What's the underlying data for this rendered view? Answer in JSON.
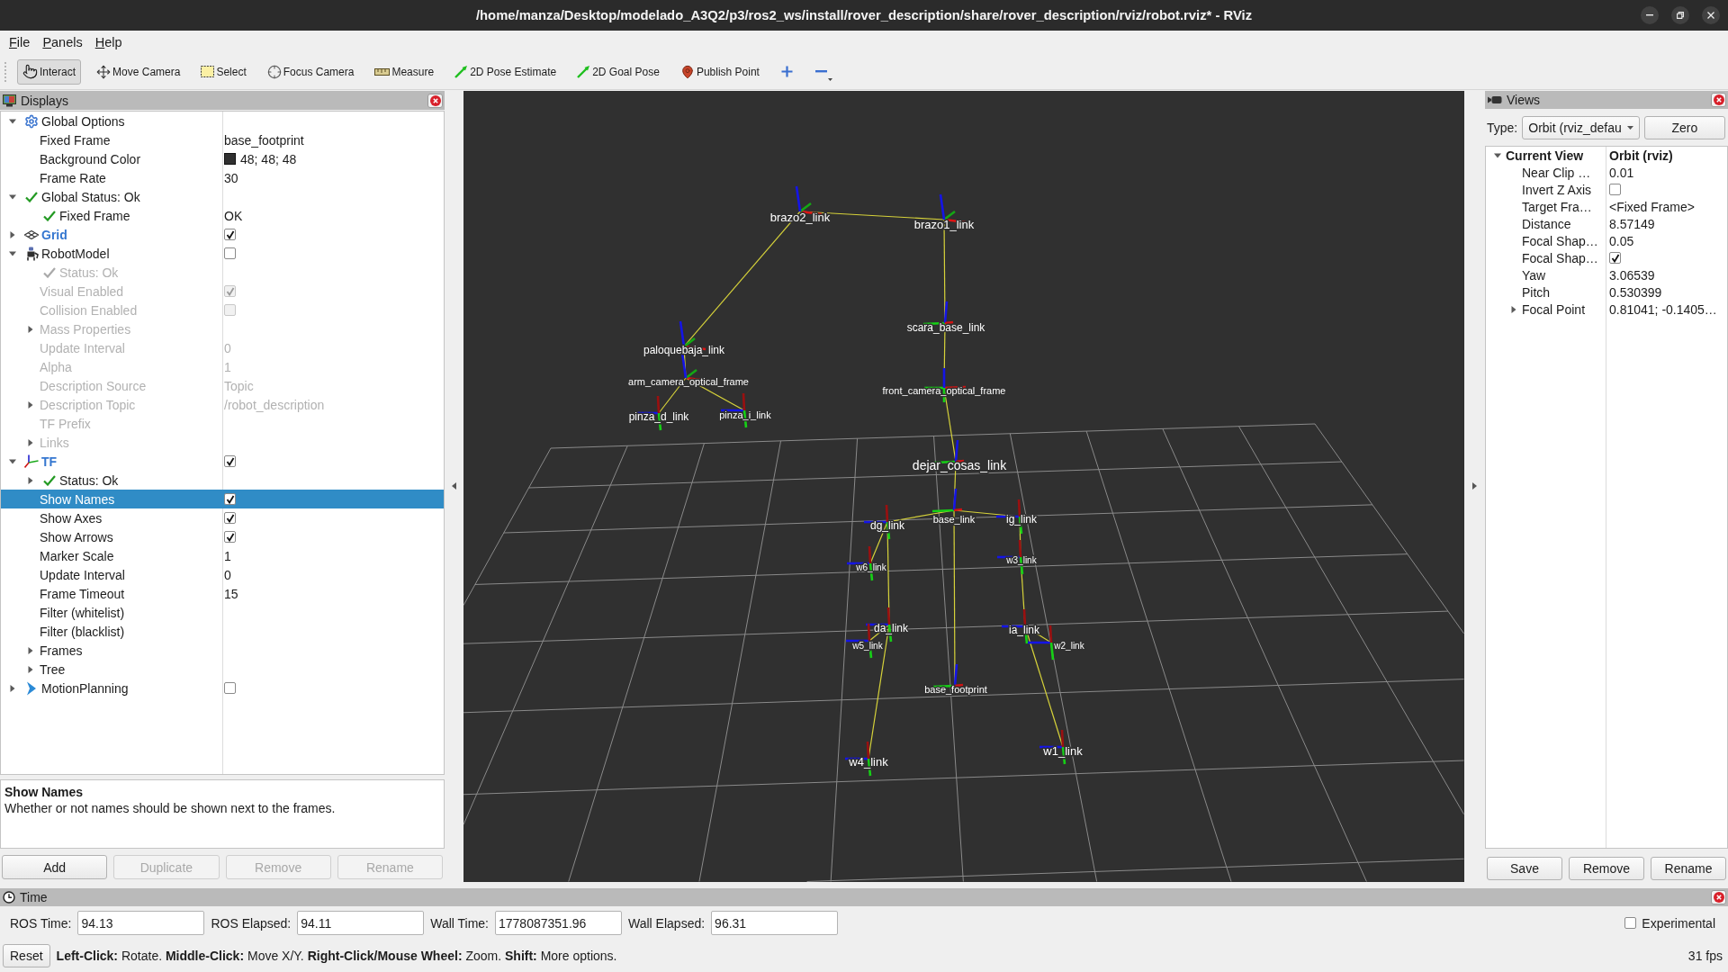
{
  "window": {
    "title": "/home/manza/Desktop/modelado_A3Q2/p3/ros2_ws/install/rover_description/share/rover_description/rviz/robot.rviz* - RViz"
  },
  "menu": [
    "File",
    "Panels",
    "Help"
  ],
  "toolbar": [
    {
      "label": "Interact",
      "selected": true
    },
    {
      "label": "Move Camera",
      "selected": false
    },
    {
      "label": "Select",
      "selected": false
    },
    {
      "label": "Focus Camera",
      "selected": false
    },
    {
      "label": "Measure",
      "selected": false
    },
    {
      "label": "2D Pose Estimate",
      "selected": false
    },
    {
      "label": "2D Goal Pose",
      "selected": false
    },
    {
      "label": "Publish Point",
      "selected": false
    }
  ],
  "displays": {
    "title": "Displays",
    "tree": [
      {
        "label": "Global Options",
        "kind": "options",
        "expanded": true,
        "selected": false,
        "children": [
          {
            "label": "Fixed Frame",
            "kind": "property",
            "value": "base_footprint",
            "selected": false
          },
          {
            "label": "Background Color",
            "kind": "property",
            "value": "48; 48; 48",
            "color": "#303030",
            "selected": false
          },
          {
            "label": "Frame Rate",
            "kind": "property",
            "value": "30",
            "selected": false
          }
        ]
      },
      {
        "label": "Global Status: Ok",
        "kind": "status",
        "expanded": true,
        "selected": false,
        "children": [
          {
            "label": "Fixed Frame",
            "kind": "status",
            "value": "OK",
            "selected": false
          }
        ]
      },
      {
        "label": "Grid",
        "kind": "display",
        "checked": true,
        "expanded": false,
        "selected": false
      },
      {
        "label": "RobotModel",
        "kind": "display",
        "checked": false,
        "expanded": true,
        "selected": false,
        "children": [
          {
            "label": "Status: Ok",
            "kind": "status",
            "selected": false
          },
          {
            "label": "Visual Enabled",
            "kind": "property",
            "checked": true,
            "selected": false
          },
          {
            "label": "Collision Enabled",
            "kind": "property",
            "checked": false,
            "selected": false
          },
          {
            "label": "Mass Properties",
            "kind": "property",
            "expanded": false,
            "selected": false
          },
          {
            "label": "Update Interval",
            "kind": "property",
            "value": "0",
            "selected": false
          },
          {
            "label": "Alpha",
            "kind": "property",
            "value": "1",
            "selected": false
          },
          {
            "label": "Description Source",
            "kind": "property",
            "value": "Topic",
            "selected": false
          },
          {
            "label": "Description Topic",
            "kind": "property",
            "value": "/robot_description",
            "expanded": false,
            "selected": false
          },
          {
            "label": "TF Prefix",
            "kind": "property",
            "selected": false
          },
          {
            "label": "Links",
            "kind": "property",
            "expanded": false,
            "selected": false
          }
        ]
      },
      {
        "label": "TF",
        "kind": "display",
        "checked": true,
        "expanded": true,
        "selected": false,
        "children": [
          {
            "label": "Status: Ok",
            "kind": "status",
            "expanded": false,
            "selected": false
          },
          {
            "label": "Show Names",
            "kind": "property",
            "checked": true,
            "selected": true
          },
          {
            "label": "Show Axes",
            "kind": "property",
            "checked": true,
            "selected": false
          },
          {
            "label": "Show Arrows",
            "kind": "property",
            "checked": true,
            "selected": false
          },
          {
            "label": "Marker Scale",
            "kind": "property",
            "value": "1",
            "selected": false
          },
          {
            "label": "Update Interval",
            "kind": "property",
            "value": "0",
            "selected": false
          },
          {
            "label": "Frame Timeout",
            "kind": "property",
            "value": "15",
            "selected": false
          },
          {
            "label": "Filter (whitelist)",
            "kind": "property",
            "selected": false
          },
          {
            "label": "Filter (blacklist)",
            "kind": "property",
            "selected": false
          },
          {
            "label": "Frames",
            "kind": "property",
            "expanded": false,
            "selected": false
          },
          {
            "label": "Tree",
            "kind": "property",
            "expanded": false,
            "selected": false
          }
        ]
      },
      {
        "label": "MotionPlanning",
        "kind": "display",
        "checked": false,
        "expanded": false,
        "selected": false
      }
    ],
    "description": {
      "title": "Show Names",
      "text": "Whether or not names should be shown next to the frames."
    },
    "buttons": [
      {
        "label": "Add",
        "disabled": false
      },
      {
        "label": "Duplicate",
        "disabled": true
      },
      {
        "label": "Remove",
        "disabled": true
      },
      {
        "label": "Rename",
        "disabled": true
      }
    ]
  },
  "viewport": {
    "frames": [
      "brazo2_link",
      "brazo1_link",
      "paloquebaja_link",
      "arm_camera_optical_frame",
      "pinza_d_link",
      "pinza_i_link",
      "scara_base_link",
      "front_camera_optical_frame",
      "dejar_cosas_link",
      "base_link",
      "dg_link",
      "ig_link",
      "w6_link",
      "w3_link",
      "da_link",
      "ia_link",
      "w5_link",
      "w2_link",
      "base_footprint",
      "w4_link",
      "w1_link"
    ]
  },
  "views": {
    "title": "Views",
    "type_label": "Type:",
    "type_value": "Orbit (rviz_defau",
    "zero_button": "Zero",
    "tree": [
      {
        "label": "Current View",
        "value": "Orbit (rviz)",
        "expanded": true,
        "selected": false,
        "children": [
          {
            "label": "Near Clip …",
            "value": "0.01",
            "selected": false
          },
          {
            "label": "Invert Z Axis",
            "checked": false,
            "selected": false
          },
          {
            "label": "Target Fra…",
            "value": "<Fixed Frame>",
            "selected": false
          },
          {
            "label": "Distance",
            "value": "8.57149",
            "selected": false
          },
          {
            "label": "Focal Shap…",
            "value": "0.05",
            "selected": false
          },
          {
            "label": "Focal Shap…",
            "checked": true,
            "selected": false
          },
          {
            "label": "Yaw",
            "value": "3.06539",
            "selected": false
          },
          {
            "label": "Pitch",
            "value": "0.530399",
            "selected": false
          },
          {
            "label": "Focal Point",
            "value": "0.81041; -0.1405…",
            "expanded": false,
            "selected": false
          }
        ]
      }
    ],
    "buttons": [
      {
        "label": "Save"
      },
      {
        "label": "Remove"
      },
      {
        "label": "Rename"
      }
    ]
  },
  "time": {
    "title": "Time",
    "fields": [
      {
        "label": "ROS Time:",
        "value": "94.13"
      },
      {
        "label": "ROS Elapsed:",
        "value": "94.11"
      },
      {
        "label": "Wall Time:",
        "value": "1778087351.96"
      },
      {
        "label": "Wall Elapsed:",
        "value": "96.31"
      }
    ],
    "experimental": {
      "label": "Experimental",
      "checked": false
    }
  },
  "status_bar": {
    "reset_button": "Reset",
    "help": "**Left-Click:** Rotate. **Middle-Click:** Move X/Y. **Right-Click/Mouse Wheel:** Zoom. **Shift:** More options.",
    "fps": "31 fps"
  }
}
